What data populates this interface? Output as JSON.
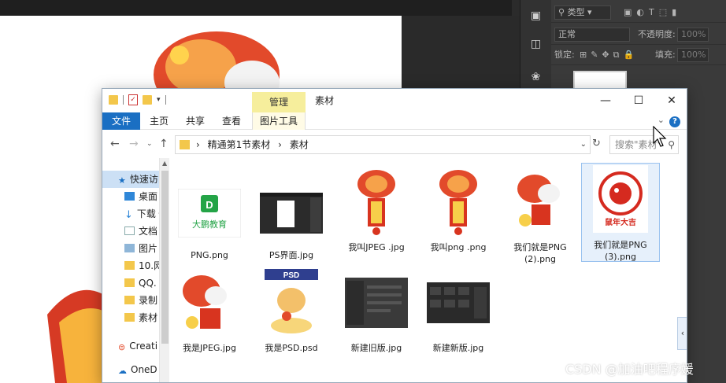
{
  "photoshop": {
    "layers_filter": "类型",
    "blend_mode": "正常",
    "opacity_label": "不透明度:",
    "opacity_value": "100%",
    "lock_label": "锁定:",
    "fill_label": "填充:",
    "fill_value": "100%"
  },
  "explorer": {
    "context_tab": "管理",
    "window_title": "素材",
    "ribbon_tabs": [
      "文件",
      "主页",
      "共享",
      "查看",
      "图片工具"
    ],
    "address": {
      "segments": [
        "精通第1节素材",
        "素材"
      ],
      "separator": "›"
    },
    "search_placeholder": "搜索\"素材\"",
    "sidebar": {
      "items": [
        {
          "label": "快速访问",
          "icon": "star-icon"
        },
        {
          "label": "桌面",
          "icon": "desktop-icon"
        },
        {
          "label": "下载",
          "icon": "download-icon"
        },
        {
          "label": "文档",
          "icon": "document-icon"
        },
        {
          "label": "图片",
          "icon": "picture-icon"
        },
        {
          "label": "10.网",
          "icon": "folder-icon"
        },
        {
          "label": "QQ.",
          "icon": "folder-icon"
        },
        {
          "label": "录制",
          "icon": "folder-icon"
        },
        {
          "label": "素材",
          "icon": "folder-icon"
        },
        {
          "label": "Creati",
          "icon": "creative-cloud-icon"
        },
        {
          "label": "OneD",
          "icon": "onedrive-icon"
        }
      ]
    },
    "files": [
      {
        "name": "PNG.png",
        "thumb": "logo"
      },
      {
        "name": "PS界面.jpg",
        "thumb": "screen"
      },
      {
        "name": "我叫JPEG .jpg",
        "thumb": "lion"
      },
      {
        "name": "我叫png .png",
        "thumb": "lion"
      },
      {
        "name": "我们就是PNG\n(2).png",
        "thumb": "lion2"
      },
      {
        "name": "我们就是PNG\n(3).png",
        "thumb": "rat"
      },
      {
        "name": "我是JPEG.jpg",
        "thumb": "lion3"
      },
      {
        "name": "我是PSD.psd",
        "thumb": "psd"
      },
      {
        "name": "新建旧版.jpg",
        "thumb": "dark"
      },
      {
        "name": "新建新版.jpg",
        "thumb": "dark2"
      }
    ],
    "logo_text": "大鹏教育",
    "rat_text": "鼠年大吉",
    "psd_badge": "PSD"
  },
  "watermark": "CSDN @加油吧程序媛"
}
